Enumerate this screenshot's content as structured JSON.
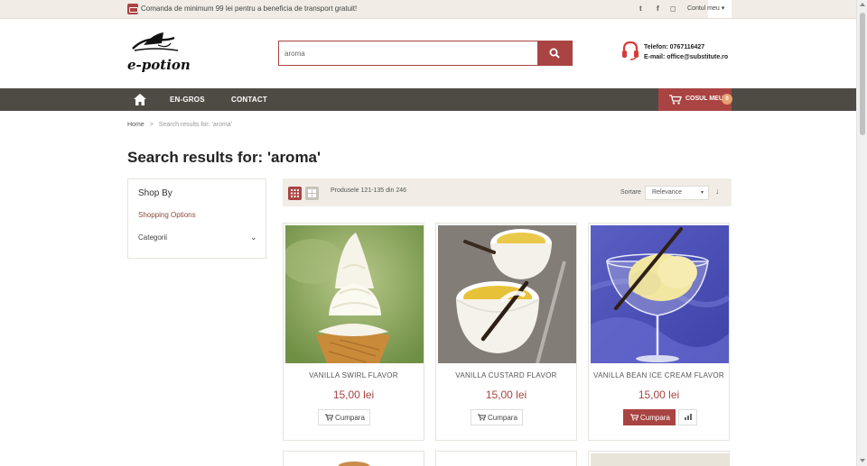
{
  "topbar": {
    "promo": "Comanda de minimum 99 lei pentru a beneficia de transport gratuit!",
    "social": {
      "twitter": "t",
      "facebook": "f",
      "instagram": "◻"
    },
    "account_label": "Contul meu ▾"
  },
  "header": {
    "logo_text": "e-potion",
    "search_value": "aroma",
    "phone": "Telefon: 0767116427",
    "email": "E-mail: office@substitute.ro"
  },
  "nav": {
    "items": [
      {
        "label": "EN-GROS"
      },
      {
        "label": "CONTACT"
      }
    ],
    "cart_label": "COSUL MEU",
    "cart_count": "0"
  },
  "breadcrumb": {
    "home": "Home",
    "sep": ">",
    "current": "Search results for: 'aroma'"
  },
  "page_title": "Search results for: 'aroma'",
  "sidebar": {
    "title": "Shop By",
    "options_title": "Shopping Options",
    "category_label": "Categorii",
    "chevron": "⌄"
  },
  "toolbar": {
    "count_text": "Produsele 121-135 din 246",
    "sort_label": "Sortare",
    "sort_value": "Relevance",
    "sort_caret": "▾",
    "sort_dir": "↓"
  },
  "products": [
    {
      "name": "VANILLA SWIRL FLAVOR",
      "price": "15,00 lei",
      "button": "Cumpara"
    },
    {
      "name": "VANILLA CUSTARD FLAVOR",
      "price": "15,00 lei",
      "button": "Cumpara"
    },
    {
      "name": "VANILLA BEAN ICE CREAM FLAVOR",
      "price": "15,00 lei",
      "button": "Cumpara"
    }
  ],
  "colors": {
    "accent": "#a94442",
    "nav_bg": "#4e4b44",
    "topbar_bg": "#f1ede6"
  }
}
